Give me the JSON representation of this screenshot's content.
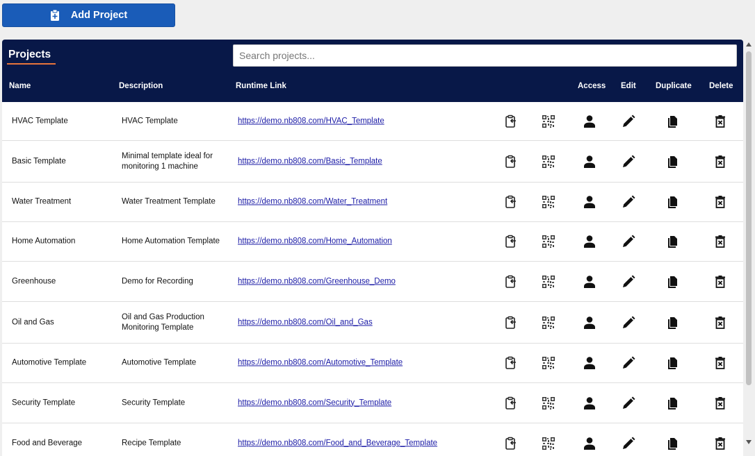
{
  "toolbar": {
    "add_label": "Add Project"
  },
  "panel": {
    "title": "Projects",
    "search_placeholder": "Search projects...",
    "columns": {
      "name": "Name",
      "description": "Description",
      "runtime_link": "Runtime Link",
      "access": "Access",
      "edit": "Edit",
      "duplicate": "Duplicate",
      "delete": "Delete"
    }
  },
  "colors": {
    "header_bg": "#081848",
    "accent": "#e8743b",
    "button": "#1a5cb8",
    "link": "#1a1aa6"
  },
  "rows": [
    {
      "name": "HVAC Template",
      "description": "HVAC Template",
      "link": "https://demo.nb808.com/HVAC_Template"
    },
    {
      "name": "Basic Template",
      "description": "Minimal template ideal for monitoring 1 machine",
      "link": "https://demo.nb808.com/Basic_Template"
    },
    {
      "name": "Water Treatment",
      "description": "Water Treatment Template",
      "link": "https://demo.nb808.com/Water_Treatment"
    },
    {
      "name": "Home Automation",
      "description": "Home Automation Template",
      "link": "https://demo.nb808.com/Home_Automation"
    },
    {
      "name": "Greenhouse",
      "description": "Demo for Recording",
      "link": "https://demo.nb808.com/Greenhouse_Demo"
    },
    {
      "name": "Oil and Gas",
      "description": "Oil and Gas Production Monitoring Template",
      "link": "https://demo.nb808.com/Oil_and_Gas"
    },
    {
      "name": "Automotive Template",
      "description": "Automotive Template",
      "link": "https://demo.nb808.com/Automotive_Template"
    },
    {
      "name": "Security Template",
      "description": "Security Template",
      "link": "https://demo.nb808.com/Security_Template"
    },
    {
      "name": "Food and Beverage",
      "description": "Recipe Template",
      "link": "https://demo.nb808.com/Food_and_Beverage_Template"
    }
  ]
}
